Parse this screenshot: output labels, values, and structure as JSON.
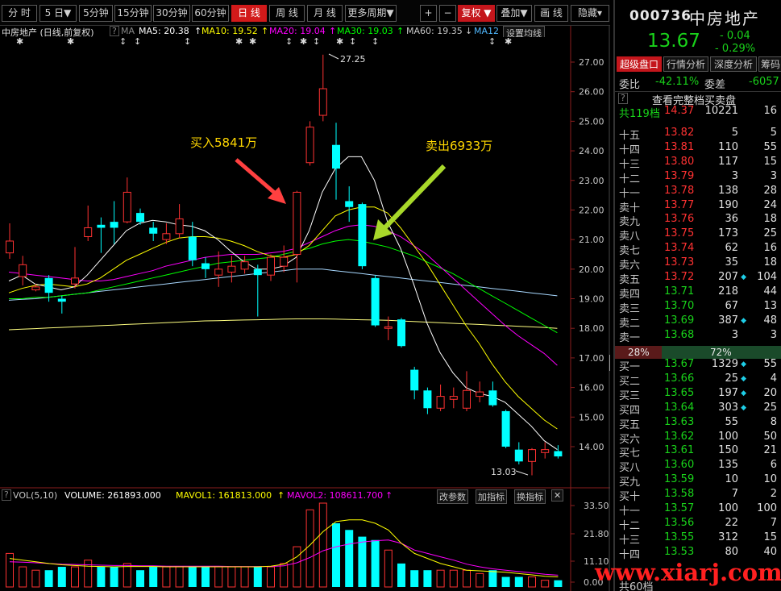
{
  "toolbar": {
    "buttons": [
      "分 时",
      "5 日▼",
      "5分钟",
      "15分钟",
      "30分钟",
      "60分钟",
      "日 线",
      "周 线",
      "月 线",
      "更多周期▼"
    ],
    "active_index": 6,
    "right": [
      "+",
      "−",
      "复权 ▼",
      "叠加▼",
      "画 线",
      "隐藏▾"
    ]
  },
  "ma_header": {
    "stock_title": "中房地产 (日线,前复权)",
    "help": "?",
    "ma": "MA",
    "ma5": "MA5: 20.38",
    "ma10": "MA10: 19.52",
    "ma20": "MA20: 19.04",
    "ma30": "MA30: 19.03",
    "ma60": "MA60: 19.35",
    "ma120": "MA12",
    "settings": "设置均线"
  },
  "colors": {
    "up": "#ff3232",
    "down": "#00ffff",
    "ma5": "#ffffff",
    "ma10": "#ffff00",
    "ma20": "#ff00ff",
    "ma30": "#00ff00",
    "ma60": "#a8d8ff",
    "ma120": "#ffff80",
    "green_text": "#19d21a",
    "red_text": "#ff3232"
  },
  "annotations": {
    "buy": "买入5841万",
    "sell": "卖出6933万",
    "high": "27.25",
    "low": "13.03"
  },
  "price_axis": [
    "27.00",
    "26.00",
    "25.00",
    "24.00",
    "23.00",
    "22.00",
    "21.00",
    "20.00",
    "19.00",
    "18.00",
    "17.00",
    "16.00",
    "15.00",
    "14.00"
  ],
  "volume_header": {
    "help": "?",
    "vol": "VOL(5,10)",
    "volume": "VOLUME: 261893.000",
    "mavol1": "MAVOL1: 161813.000",
    "mavol2": "MAVOL2: 108611.700",
    "btn_params": "改参数",
    "btn_add": "加指标",
    "btn_switch": "换指标",
    "btn_close": "✕"
  },
  "volume_axis": [
    "33.50",
    "21.80",
    "11.10",
    "0.00"
  ],
  "chart_data": {
    "type": "candlestick",
    "candles": [
      {
        "o": 20.55,
        "c": 20.95,
        "h": 21.55,
        "l": 20.35
      },
      {
        "o": 19.75,
        "c": 20.15,
        "h": 20.45,
        "l": 19.45
      },
      {
        "o": 19.3,
        "c": 19.4,
        "h": 19.5,
        "l": 19.25
      },
      {
        "o": 19.7,
        "c": 19.2,
        "h": 19.8,
        "l": 18.9
      },
      {
        "o": 19.0,
        "c": 18.9,
        "h": 19.1,
        "l": 18.5
      },
      {
        "o": 19.5,
        "c": 19.7,
        "h": 20.75,
        "l": 19.35
      },
      {
        "o": 21.1,
        "c": 21.4,
        "h": 22.15,
        "l": 20.95
      },
      {
        "o": 21.5,
        "c": 21.4,
        "h": 21.75,
        "l": 20.55
      },
      {
        "o": 21.6,
        "c": 21.4,
        "h": 22.3,
        "l": 20.85
      },
      {
        "o": 21.6,
        "c": 22.6,
        "h": 23.1,
        "l": 21.55
      },
      {
        "o": 21.9,
        "c": 21.6,
        "h": 22.05,
        "l": 21.5
      },
      {
        "o": 21.4,
        "c": 21.2,
        "h": 21.6,
        "l": 20.95
      },
      {
        "o": 21.0,
        "c": 21.2,
        "h": 21.55,
        "l": 20.85
      },
      {
        "o": 21.2,
        "c": 21.7,
        "h": 22.2,
        "l": 21.05
      },
      {
        "o": 21.1,
        "c": 20.3,
        "h": 21.6,
        "l": 20.1
      },
      {
        "o": 20.2,
        "c": 20.0,
        "h": 20.4,
        "l": 19.7
      },
      {
        "o": 19.8,
        "c": 20.0,
        "h": 20.6,
        "l": 19.4
      },
      {
        "o": 19.9,
        "c": 20.1,
        "h": 20.45,
        "l": 19.55
      },
      {
        "o": 20.0,
        "c": 20.25,
        "h": 20.45,
        "l": 19.85
      },
      {
        "o": 20.0,
        "c": 19.8,
        "h": 20.15,
        "l": 18.4
      },
      {
        "o": 19.8,
        "c": 20.4,
        "h": 20.5,
        "l": 19.6
      },
      {
        "o": 20.1,
        "c": 20.4,
        "h": 20.8,
        "l": 19.9
      },
      {
        "o": 20.5,
        "c": 22.6,
        "h": 22.65,
        "l": 19.55
      },
      {
        "o": 23.6,
        "c": 24.8,
        "h": 25.0,
        "l": 23.5
      },
      {
        "o": 25.2,
        "c": 26.1,
        "h": 27.25,
        "l": 25.0
      },
      {
        "o": 24.2,
        "c": 23.4,
        "h": 24.95,
        "l": 22.35
      },
      {
        "o": 22.3,
        "c": 22.1,
        "h": 22.8,
        "l": 21.6
      },
      {
        "o": 22.2,
        "c": 20.1,
        "h": 22.25,
        "l": 20.0
      },
      {
        "o": 19.7,
        "c": 18.1,
        "h": 19.8,
        "l": 18.05
      },
      {
        "o": 18.0,
        "c": 18.05,
        "h": 18.4,
        "l": 17.6
      },
      {
        "o": 18.3,
        "c": 17.4,
        "h": 18.35,
        "l": 17.35
      },
      {
        "o": 16.6,
        "c": 15.9,
        "h": 16.7,
        "l": 15.6
      },
      {
        "o": 15.9,
        "c": 15.3,
        "h": 16.0,
        "l": 15.1
      },
      {
        "o": 15.3,
        "c": 15.7,
        "h": 16.1,
        "l": 15.2
      },
      {
        "o": 15.6,
        "c": 15.7,
        "h": 16.0,
        "l": 15.3
      },
      {
        "o": 15.3,
        "c": 15.9,
        "h": 16.55,
        "l": 15.2
      },
      {
        "o": 15.7,
        "c": 15.85,
        "h": 16.2,
        "l": 15.5
      },
      {
        "o": 15.9,
        "c": 15.4,
        "h": 16.2,
        "l": 15.35
      },
      {
        "o": 15.2,
        "c": 14.0,
        "h": 15.25,
        "l": 13.95
      },
      {
        "o": 13.9,
        "c": 13.5,
        "h": 14.15,
        "l": 13.4
      },
      {
        "o": 13.5,
        "c": 13.9,
        "h": 13.95,
        "l": 13.03
      },
      {
        "o": 13.8,
        "c": 13.9,
        "h": 14.15,
        "l": 13.6
      },
      {
        "o": 13.85,
        "c": 13.67,
        "h": 14.05,
        "l": 13.6
      }
    ],
    "ma5": [
      19.6,
      19.8,
      19.5,
      19.4,
      19.3,
      19.4,
      19.8,
      20.3,
      20.8,
      21.3,
      21.55,
      21.65,
      21.6,
      21.5,
      21.45,
      21.3,
      21.0,
      20.6,
      20.25,
      20.0,
      20.0,
      20.1,
      20.4,
      21.3,
      22.6,
      23.4,
      23.8,
      23.8,
      23.0,
      21.6,
      20.7,
      19.5,
      18.2,
      17.2,
      16.5,
      16.0,
      15.8,
      15.7,
      15.5,
      15.1,
      14.7,
      14.2,
      13.9
    ],
    "ma10": [
      19.2,
      19.35,
      19.45,
      19.5,
      19.45,
      19.4,
      19.5,
      19.7,
      20.0,
      20.3,
      20.5,
      20.7,
      20.9,
      21.05,
      21.1,
      21.1,
      21.05,
      20.95,
      20.8,
      20.6,
      20.45,
      20.4,
      20.5,
      20.8,
      21.3,
      21.8,
      22.0,
      22.1,
      22.1,
      21.9,
      21.4,
      20.8,
      20.2,
      19.5,
      18.8,
      18.1,
      17.5,
      16.8,
      16.2,
      15.7,
      15.3,
      14.9,
      14.6
    ],
    "ma20": [
      19.9,
      19.85,
      19.8,
      19.75,
      19.7,
      19.65,
      19.6,
      19.6,
      19.65,
      19.75,
      19.85,
      19.95,
      20.1,
      20.2,
      20.3,
      20.4,
      20.45,
      20.5,
      20.5,
      20.5,
      20.55,
      20.6,
      20.7,
      20.9,
      21.1,
      21.3,
      21.45,
      21.5,
      21.45,
      21.3,
      21.1,
      20.8,
      20.5,
      20.1,
      19.7,
      19.3,
      18.9,
      18.5,
      18.1,
      17.75,
      17.45,
      17.15,
      16.75
    ],
    "ma30": [
      19.0,
      19.0,
      19.05,
      19.05,
      19.1,
      19.15,
      19.2,
      19.3,
      19.4,
      19.5,
      19.6,
      19.7,
      19.8,
      19.9,
      20.0,
      20.1,
      20.2,
      20.25,
      20.3,
      20.35,
      20.4,
      20.5,
      20.6,
      20.7,
      20.85,
      20.95,
      21.0,
      20.95,
      20.85,
      20.75,
      20.6,
      20.45,
      20.25,
      20.05,
      19.85,
      19.6,
      19.35,
      19.1,
      18.85,
      18.6,
      18.35,
      18.1,
      17.85
    ],
    "ma60": [
      18.95,
      18.98,
      19.0,
      19.05,
      19.1,
      19.15,
      19.2,
      19.25,
      19.3,
      19.35,
      19.4,
      19.45,
      19.5,
      19.55,
      19.6,
      19.65,
      19.7,
      19.75,
      19.8,
      19.85,
      19.9,
      19.95,
      20.0,
      20.0,
      20.0,
      19.95,
      19.9,
      19.85,
      19.8,
      19.75,
      19.7,
      19.65,
      19.6,
      19.55,
      19.5,
      19.45,
      19.4,
      19.35,
      19.3,
      19.25,
      19.2,
      19.15,
      19.1
    ],
    "ma120": [
      17.95,
      17.97,
      17.99,
      18.01,
      18.03,
      18.05,
      18.07,
      18.09,
      18.11,
      18.13,
      18.15,
      18.17,
      18.19,
      18.21,
      18.23,
      18.25,
      18.26,
      18.27,
      18.28,
      18.29,
      18.3,
      18.31,
      18.32,
      18.32,
      18.32,
      18.31,
      18.3,
      18.29,
      18.28,
      18.27,
      18.25,
      18.23,
      18.21,
      18.19,
      18.17,
      18.15,
      18.13,
      18.11,
      18.09,
      18.07,
      18.05,
      18.03,
      18.0
    ],
    "volumes": [
      0.1,
      0.06,
      0.05,
      0.05,
      0.06,
      0.06,
      0.08,
      0.06,
      0.06,
      0.07,
      0.05,
      0.06,
      0.06,
      0.06,
      0.06,
      0.06,
      0.06,
      0.06,
      0.06,
      0.06,
      0.06,
      0.07,
      0.12,
      0.23,
      0.25,
      0.19,
      0.17,
      0.15,
      0.14,
      0.11,
      0.07,
      0.05,
      0.05,
      0.05,
      0.05,
      0.05,
      0.04,
      0.05,
      0.03,
      0.03,
      0.03,
      0.02,
      0.02
    ],
    "mavol1": [
      0.085,
      0.08,
      0.075,
      0.07,
      0.066,
      0.064,
      0.062,
      0.061,
      0.06,
      0.061,
      0.061,
      0.061,
      0.06,
      0.06,
      0.06,
      0.06,
      0.06,
      0.06,
      0.06,
      0.06,
      0.062,
      0.068,
      0.09,
      0.125,
      0.165,
      0.195,
      0.2,
      0.2,
      0.19,
      0.17,
      0.13,
      0.1,
      0.085,
      0.07,
      0.06,
      0.05,
      0.048,
      0.046,
      0.044,
      0.04,
      0.036,
      0.032,
      0.03
    ],
    "mavol2": [
      0.075,
      0.074,
      0.072,
      0.07,
      0.068,
      0.067,
      0.066,
      0.065,
      0.064,
      0.064,
      0.063,
      0.063,
      0.062,
      0.062,
      0.062,
      0.062,
      0.062,
      0.061,
      0.061,
      0.061,
      0.061,
      0.063,
      0.072,
      0.088,
      0.108,
      0.12,
      0.128,
      0.134,
      0.138,
      0.14,
      0.13,
      0.11,
      0.1,
      0.09,
      0.08,
      0.068,
      0.06,
      0.054,
      0.05,
      0.046,
      0.042,
      0.038,
      0.035
    ],
    "ylim": [
      13.0,
      27.5
    ]
  },
  "quote": {
    "code": "000736",
    "name": "中房地产",
    "price": "13.67",
    "change": "- 0.04",
    "change_pct": "- 0.29%",
    "tabs": [
      "超级盘口",
      "行情分析",
      "深度分析",
      "筹码"
    ],
    "wb_label": "委比",
    "wb_value": "-42.11%",
    "wc_label": "委差",
    "wc_value": "-6057",
    "help": "?",
    "full_book": "查看完整档买卖盘",
    "total_label": "共119档",
    "total_price": "14.37",
    "total_vol": "10221",
    "total_cnt": "16",
    "asks": [
      {
        "label": "十五",
        "price": "13.82",
        "vol": "5",
        "cnt": "5"
      },
      {
        "label": "十四",
        "price": "13.81",
        "vol": "110",
        "cnt": "55"
      },
      {
        "label": "十三",
        "price": "13.80",
        "vol": "117",
        "cnt": "15"
      },
      {
        "label": "十二",
        "price": "13.79",
        "vol": "3",
        "cnt": "3"
      },
      {
        "label": "十一",
        "price": "13.78",
        "vol": "138",
        "cnt": "28"
      },
      {
        "label": "卖十",
        "price": "13.77",
        "vol": "190",
        "cnt": "24"
      },
      {
        "label": "卖九",
        "price": "13.76",
        "vol": "36",
        "cnt": "18"
      },
      {
        "label": "卖八",
        "price": "13.75",
        "vol": "173",
        "cnt": "25"
      },
      {
        "label": "卖七",
        "price": "13.74",
        "vol": "62",
        "cnt": "16"
      },
      {
        "label": "卖六",
        "price": "13.73",
        "vol": "35",
        "cnt": "18"
      },
      {
        "label": "卖五",
        "price": "13.72",
        "vol": "207",
        "cnt": "104",
        "dot": "◆"
      },
      {
        "label": "卖四",
        "price": "13.71",
        "vol": "218",
        "cnt": "44"
      },
      {
        "label": "卖三",
        "price": "13.70",
        "vol": "67",
        "cnt": "13"
      },
      {
        "label": "卖二",
        "price": "13.69",
        "vol": "387",
        "cnt": "48",
        "dot": "◆"
      },
      {
        "label": "卖一",
        "price": "13.68",
        "vol": "3",
        "cnt": "3"
      }
    ],
    "ratio_left": "28%",
    "ratio_right": "72%",
    "ratio_fraction": 0.28,
    "bids": [
      {
        "label": "买一",
        "price": "13.67",
        "vol": "1329",
        "cnt": "55",
        "dot": "◆"
      },
      {
        "label": "买二",
        "price": "13.66",
        "vol": "25",
        "cnt": "4",
        "dot": "◆"
      },
      {
        "label": "买三",
        "price": "13.65",
        "vol": "197",
        "cnt": "20",
        "dot": "◆"
      },
      {
        "label": "买四",
        "price": "13.64",
        "vol": "303",
        "cnt": "25",
        "dot": "◆"
      },
      {
        "label": "买五",
        "price": "13.63",
        "vol": "55",
        "cnt": "8"
      },
      {
        "label": "买六",
        "price": "13.62",
        "vol": "100",
        "cnt": "50"
      },
      {
        "label": "买七",
        "price": "13.61",
        "vol": "150",
        "cnt": "21"
      },
      {
        "label": "买八",
        "price": "13.60",
        "vol": "135",
        "cnt": "6"
      },
      {
        "label": "买九",
        "price": "13.59",
        "vol": "10",
        "cnt": "10"
      },
      {
        "label": "买十",
        "price": "13.58",
        "vol": "7",
        "cnt": "2"
      },
      {
        "label": "十一",
        "price": "13.57",
        "vol": "100",
        "cnt": "100"
      },
      {
        "label": "十二",
        "price": "13.56",
        "vol": "22",
        "cnt": "7"
      },
      {
        "label": "十三",
        "price": "13.55",
        "vol": "312",
        "cnt": "15"
      },
      {
        "label": "十四",
        "price": "13.53",
        "vol": "80",
        "cnt": "40"
      }
    ],
    "last_label": "共60档"
  },
  "watermark": "www.xiarj.com"
}
